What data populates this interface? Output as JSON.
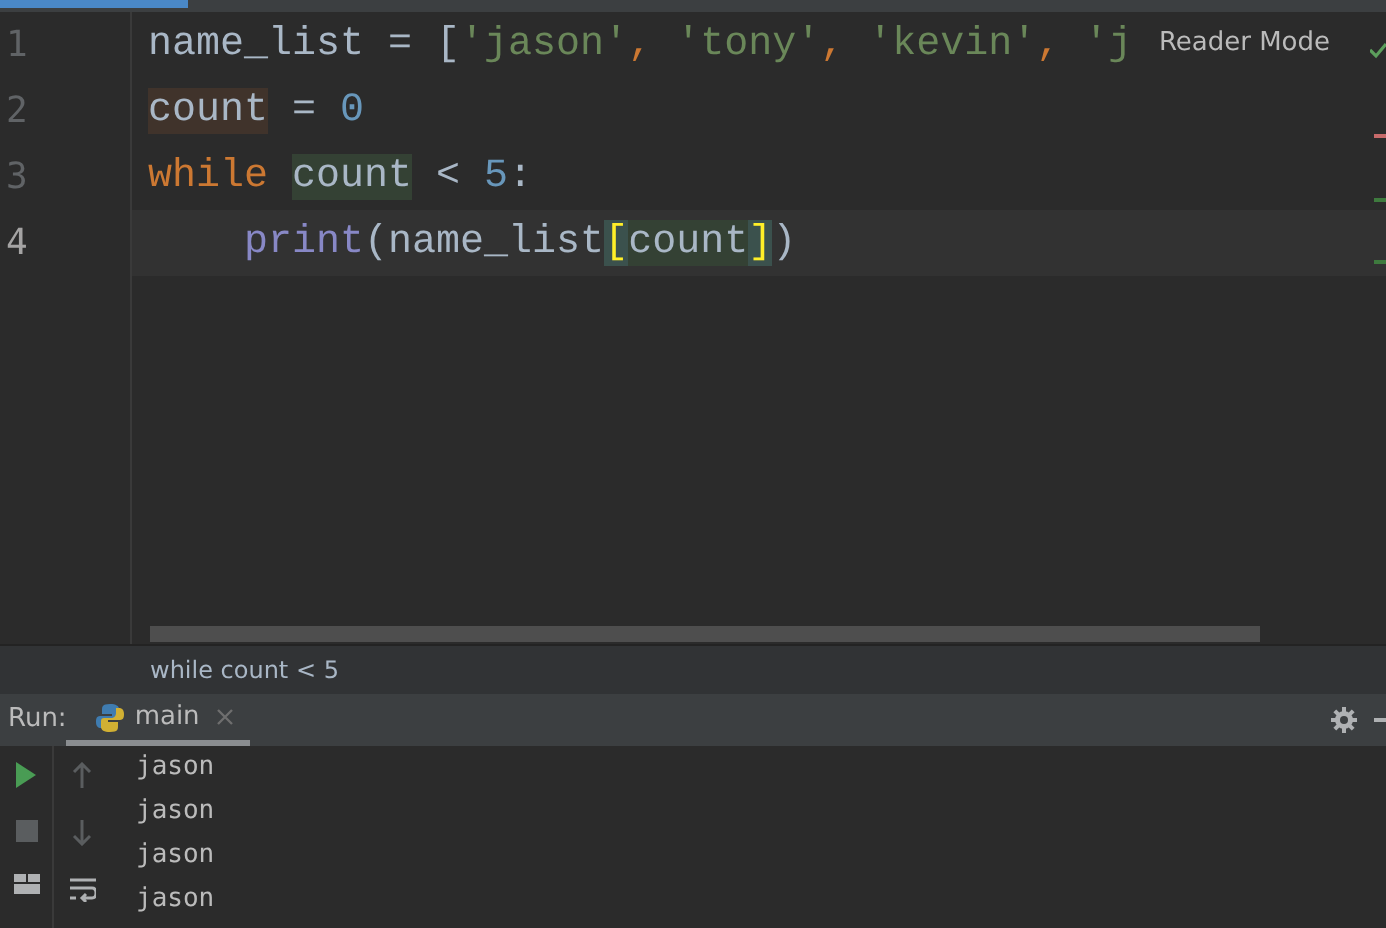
{
  "code_lines": [
    {
      "number": "1",
      "current": false,
      "tokens": [
        {
          "t": "name_list = [",
          "kind": "plain"
        },
        {
          "t": "'jason'",
          "kind": "str"
        },
        {
          "t": ",",
          "kind": "comma"
        },
        {
          "t": " 'tony'",
          "kind": "str"
        },
        {
          "t": ",",
          "kind": "comma"
        },
        {
          "t": " 'kevin'",
          "kind": "str"
        },
        {
          "t": ",",
          "kind": "comma"
        },
        {
          "t": " 'j",
          "kind": "str"
        }
      ]
    },
    {
      "number": "2",
      "current": false,
      "tokens": [
        {
          "t": "count",
          "kind": "plain",
          "write_usage": true
        },
        {
          "t": " = ",
          "kind": "plain"
        },
        {
          "t": "0",
          "kind": "num"
        }
      ]
    },
    {
      "number": "3",
      "current": false,
      "tokens": [
        {
          "t": "while ",
          "kind": "kw"
        },
        {
          "t": "count",
          "kind": "plain",
          "read_usage": true
        },
        {
          "t": " < ",
          "kind": "plain"
        },
        {
          "t": "5",
          "kind": "num"
        },
        {
          "t": ":",
          "kind": "plain"
        }
      ]
    },
    {
      "number": "4",
      "current": true,
      "tokens": [
        {
          "t": "    print",
          "kind": "builtin"
        },
        {
          "t": "(name_list",
          "kind": "plain"
        },
        {
          "t": "[",
          "kind": "brace",
          "brace_match": true
        },
        {
          "t": "count",
          "kind": "plain",
          "read_usage": true
        },
        {
          "t": "]",
          "kind": "brace",
          "brace_match": true
        },
        {
          "t": ")",
          "kind": "plain"
        }
      ]
    }
  ],
  "reader_mode": "Reader Mode",
  "breadcrumb": "while count < 5",
  "run_panel": {
    "label": "Run:",
    "tabs": [
      {
        "label": "main",
        "selected": true
      }
    ],
    "output": [
      "jason",
      "jason",
      "jason",
      "jason"
    ]
  }
}
